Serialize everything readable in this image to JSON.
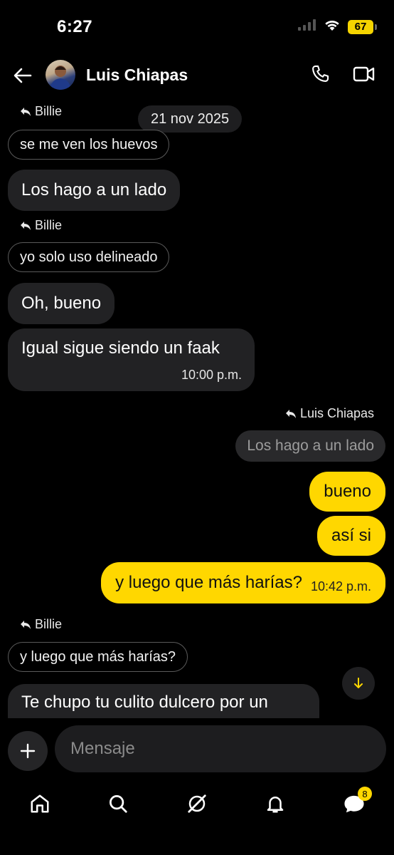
{
  "status": {
    "time": "6:27",
    "battery": "67"
  },
  "header": {
    "contact_name": "Luis Chiapas"
  },
  "date_chip": "21 nov 2025",
  "messages": [
    {
      "reply_to": "Billie",
      "quote": "se me ven los huevos",
      "text": "Los hago a un lado"
    },
    {
      "reply_to": "Billie",
      "quote": "yo solo uso delineado",
      "text": "Oh, bueno"
    },
    {
      "text": "Igual sigue siendo un faak",
      "time": "10:00 p.m."
    }
  ],
  "outgoing": [
    {
      "reply_to": "Luis Chiapas",
      "quote": "Los hago a un lado",
      "text": "bueno"
    },
    {
      "text": "así si"
    },
    {
      "text": "y luego que más harías?",
      "time": "10:42 p.m."
    }
  ],
  "last_incoming": {
    "reply_to": "Billie",
    "quote": "y luego que más harías?",
    "text": "Te chupo tu culito dulcero por un"
  },
  "composer": {
    "placeholder": "Mensaje"
  },
  "nav": {
    "messages_badge": "8"
  },
  "colors": {
    "accent": "#ffd700",
    "bubble_incoming": "#222224",
    "background": "#000000"
  },
  "icons": [
    "back-arrow-icon",
    "phone-icon",
    "video-icon",
    "reply-icon",
    "chevron-down-icon",
    "plus-icon",
    "home-icon",
    "search-icon",
    "grok-icon",
    "bell-icon",
    "messages-icon"
  ]
}
